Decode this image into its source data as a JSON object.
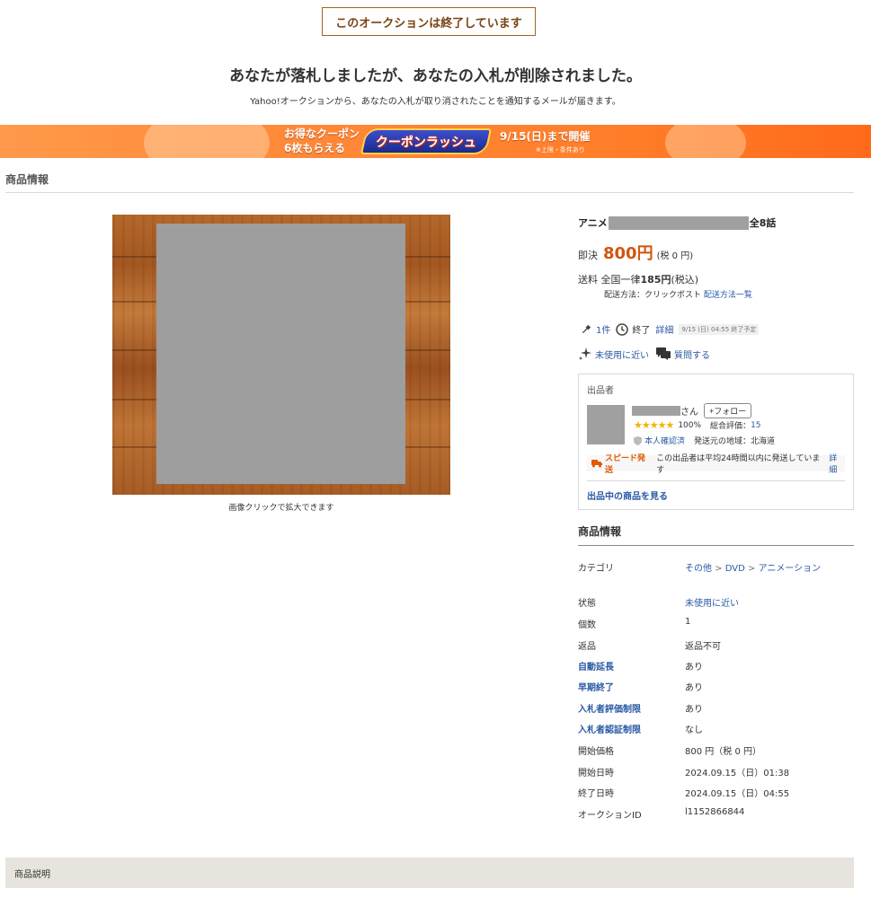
{
  "status": {
    "ended_label": "このオークションは終了しています",
    "headline": "あなたが落札しましたが、あなたの入札が削除されました。",
    "subline": "Yahoo!オークションから、あなたの入札が取り消されたことを通知するメールが届きます。"
  },
  "banner": {
    "left_line1": "お得なクーポン",
    "left_line2": "6枚もらえる",
    "logo_text": "クーポンラッシュ",
    "right_text": "9/15(日)まで開催",
    "note": "※上限・条件あり"
  },
  "section_title": "商品情報",
  "photo": {
    "caption": "画像クリックで拡大できます"
  },
  "item": {
    "title_prefix": "アニメ",
    "title_suffix": "全8話",
    "price_label": "即決",
    "price_value": "800円",
    "price_tax": "(税 0 円)",
    "ship_label": "送料",
    "ship_value_pre": "全国一律",
    "ship_value_price": "185円",
    "ship_value_post": "(税込)",
    "ship_method": "配送方法：クリックポスト",
    "ship_method_link": "配送方法一覧",
    "bids": "1件",
    "ended": "終了",
    "detail_link": "詳細",
    "end_note": "9/15 (日) 04:55 終了予定",
    "condition_link": "未使用に近い",
    "question_link": "質問する"
  },
  "seller": {
    "header": "出品者",
    "name_suffix": "さん",
    "follow_label": "+フォロー",
    "rating_pct": "100%",
    "total_label": "総合評価：",
    "total_value": "15",
    "verified": "本人確認済",
    "region": "発送元の地域：北海道",
    "speed_tag": "スピード発送",
    "speed_text": "この出品者は平均24時間以内に発送しています",
    "speed_link": "詳細",
    "more_link": "出品中の商品を見る"
  },
  "info": {
    "title": "商品情報",
    "category_label": "カテゴリ",
    "category_path": [
      "その他",
      "DVD",
      "アニメーション"
    ],
    "rows": [
      {
        "k": "状態",
        "v": "未使用に近い"
      },
      {
        "k": "個数",
        "v": "1"
      },
      {
        "k": "返品",
        "v": "返品不可"
      },
      {
        "k": "自動延長",
        "v": "あり"
      },
      {
        "k": "早期終了",
        "v": "あり"
      },
      {
        "k": "入札者評価制限",
        "v": "あり"
      },
      {
        "k": "入札者認証制限",
        "v": "なし"
      },
      {
        "k": "開始価格",
        "v": "800 円（税 0 円）"
      },
      {
        "k": "開始日時",
        "v": "2024.09.15（日）01:38"
      },
      {
        "k": "終了日時",
        "v": "2024.09.15（日）04:55"
      },
      {
        "k": "オークションID",
        "v": "l1152866844"
      }
    ]
  },
  "description_label": "商品説明"
}
